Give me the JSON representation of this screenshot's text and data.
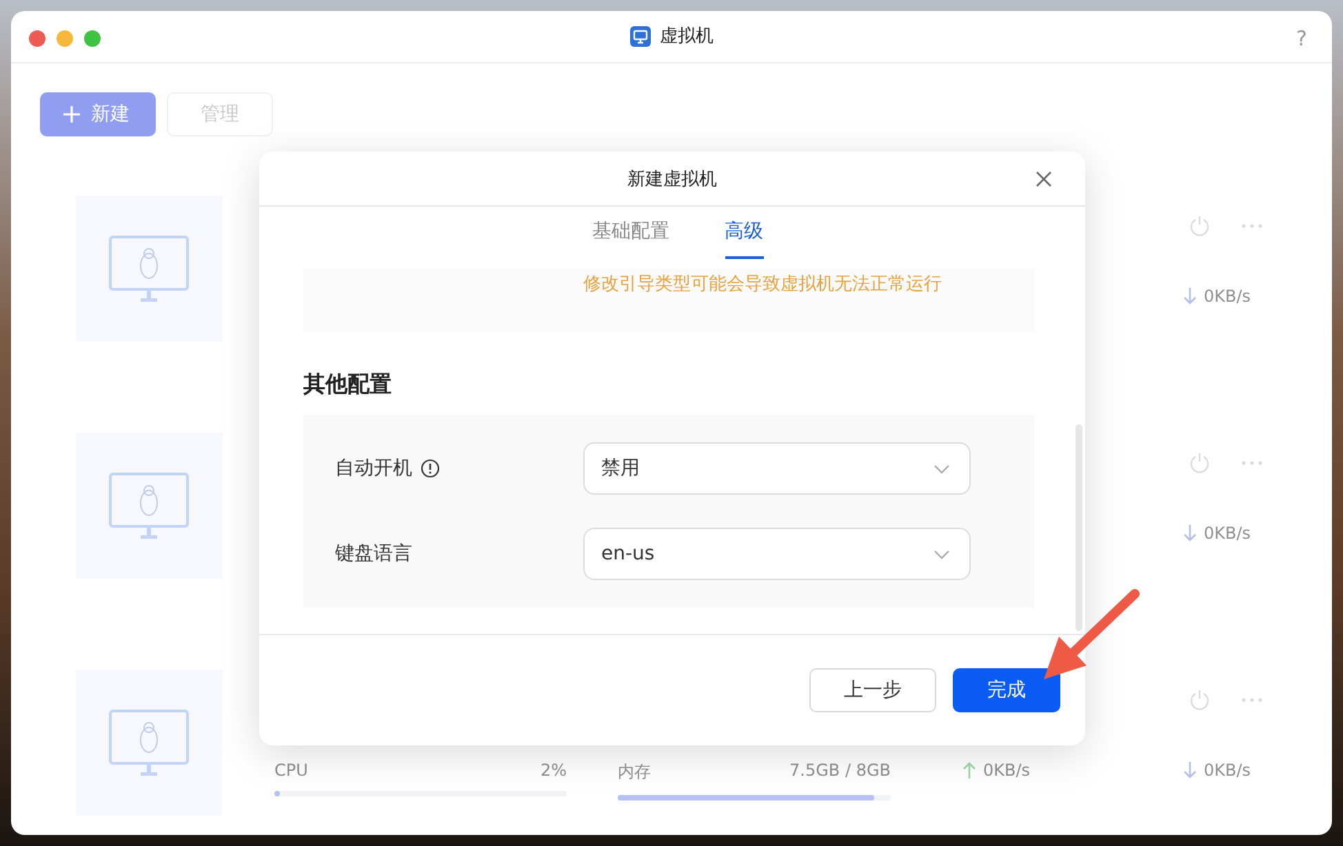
{
  "window": {
    "title": "虚拟机",
    "help": "?"
  },
  "toolbar": {
    "buttons": [
      {
        "label": "新建",
        "kind": "primary"
      },
      {
        "label": "管理",
        "kind": "secondary"
      }
    ]
  },
  "vms": [
    {
      "download": "0KB/s"
    },
    {
      "download": "0KB/s"
    },
    {
      "cpu": {
        "label": "CPU",
        "value": "2%",
        "level": 0.02
      },
      "memory": {
        "label": "内存",
        "value": "7.5GB / 8GB",
        "level": 0.94
      },
      "upload": "0KB/s",
      "download": "0KB/s"
    }
  ],
  "dialog": {
    "title": "新建虚拟机",
    "tabs": [
      {
        "label": "基础配置",
        "selected": false
      },
      {
        "label": "高级",
        "selected": true
      }
    ],
    "warning": "修改引导类型可能会导致虚拟机无法正常运行",
    "section_title": "其他配置",
    "fields": [
      {
        "label": "自动开机",
        "info": true,
        "value": "禁用"
      },
      {
        "label": "键盘语言",
        "info": false,
        "value": "en-us"
      }
    ],
    "buttons": [
      {
        "label": "上一步",
        "kind": "secondary"
      },
      {
        "label": "完成",
        "kind": "primary"
      }
    ]
  }
}
